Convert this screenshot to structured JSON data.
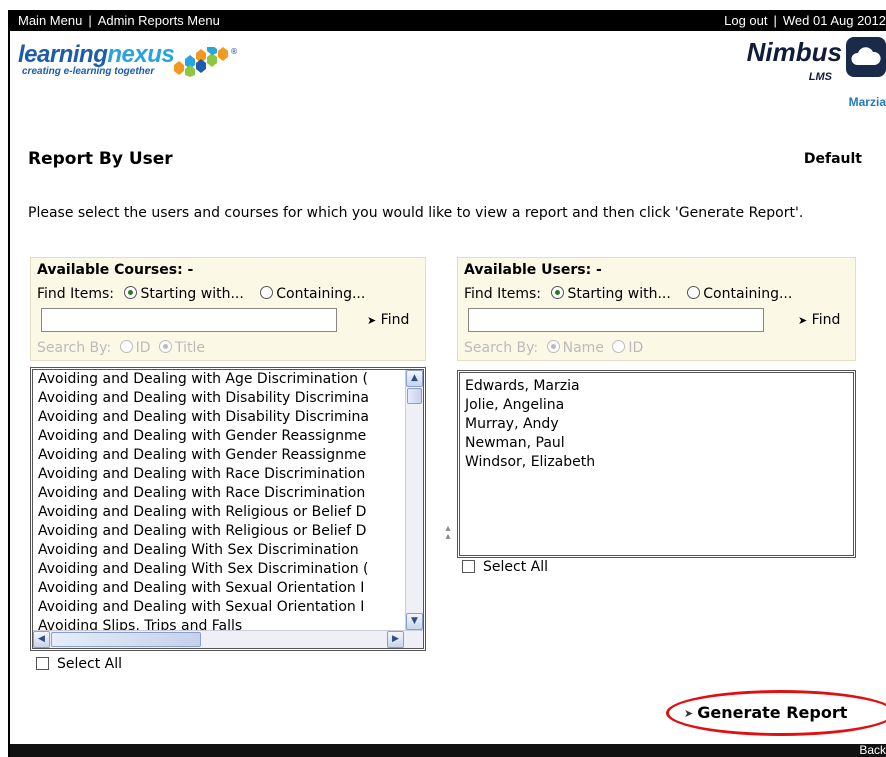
{
  "topbar": {
    "main_menu": "Main Menu",
    "admin_reports_menu": "Admin Reports Menu",
    "log_out": "Log out",
    "date": "Wed 01 Aug 2012"
  },
  "header": {
    "logo_word_a": "learning",
    "logo_word_b": "nexus",
    "logo_tagline": "creating e-learning together",
    "brand": "Nimbus",
    "brand_sub": "LMS",
    "user_name": "Marzia"
  },
  "page": {
    "title": "Report By User",
    "default_link": "Default",
    "instructions": "Please select the users and courses for which you would like to view a report and then click 'Generate Report'."
  },
  "courses_panel": {
    "heading": "Available Courses: -",
    "find_items_label": "Find Items:",
    "option_starting": "Starting with...",
    "option_containing": "Containing...",
    "find_button": "Find",
    "search_by_label": "Search By:",
    "search_by_options": [
      "ID",
      "Title"
    ],
    "items": [
      "Avoiding and Dealing with Age Discrimination (",
      "Avoiding and Dealing with Disability Discrimina",
      "Avoiding and Dealing with Disability Discrimina",
      "Avoiding and Dealing with Gender Reassignme",
      "Avoiding and Dealing with Gender Reassignme",
      "Avoiding and Dealing with Race Discrimination",
      "Avoiding and Dealing with Race Discrimination",
      "Avoiding and Dealing with Religious or Belief D",
      "Avoiding and Dealing with Religious or Belief D",
      "Avoiding and Dealing With Sex Discrimination",
      "Avoiding and Dealing With Sex Discrimination (",
      "Avoiding and Dealing with Sexual Orientation I",
      "Avoiding and Dealing with Sexual Orientation I",
      "Avoiding Slips, Trips and Falls"
    ],
    "select_all": "Select All"
  },
  "users_panel": {
    "heading": "Available Users: -",
    "find_items_label": "Find Items:",
    "option_starting": "Starting with...",
    "option_containing": "Containing...",
    "find_button": "Find",
    "search_by_label": "Search By:",
    "search_by_options": [
      "Name",
      "ID"
    ],
    "items": [
      "Edwards, Marzia",
      "Jolie, Angelina",
      "Murray, Andy",
      "Newman, Paul",
      "Windsor, Elizabeth"
    ],
    "select_all": "Select All"
  },
  "actions": {
    "generate_report": "Generate Report"
  },
  "footer": {
    "back": "Back"
  },
  "colors": {
    "panel_bg": "#fbf8e6",
    "highlight_ellipse": "#e01010",
    "brand_blue": "#1c5cab",
    "user_link": "#1f7ac2"
  }
}
